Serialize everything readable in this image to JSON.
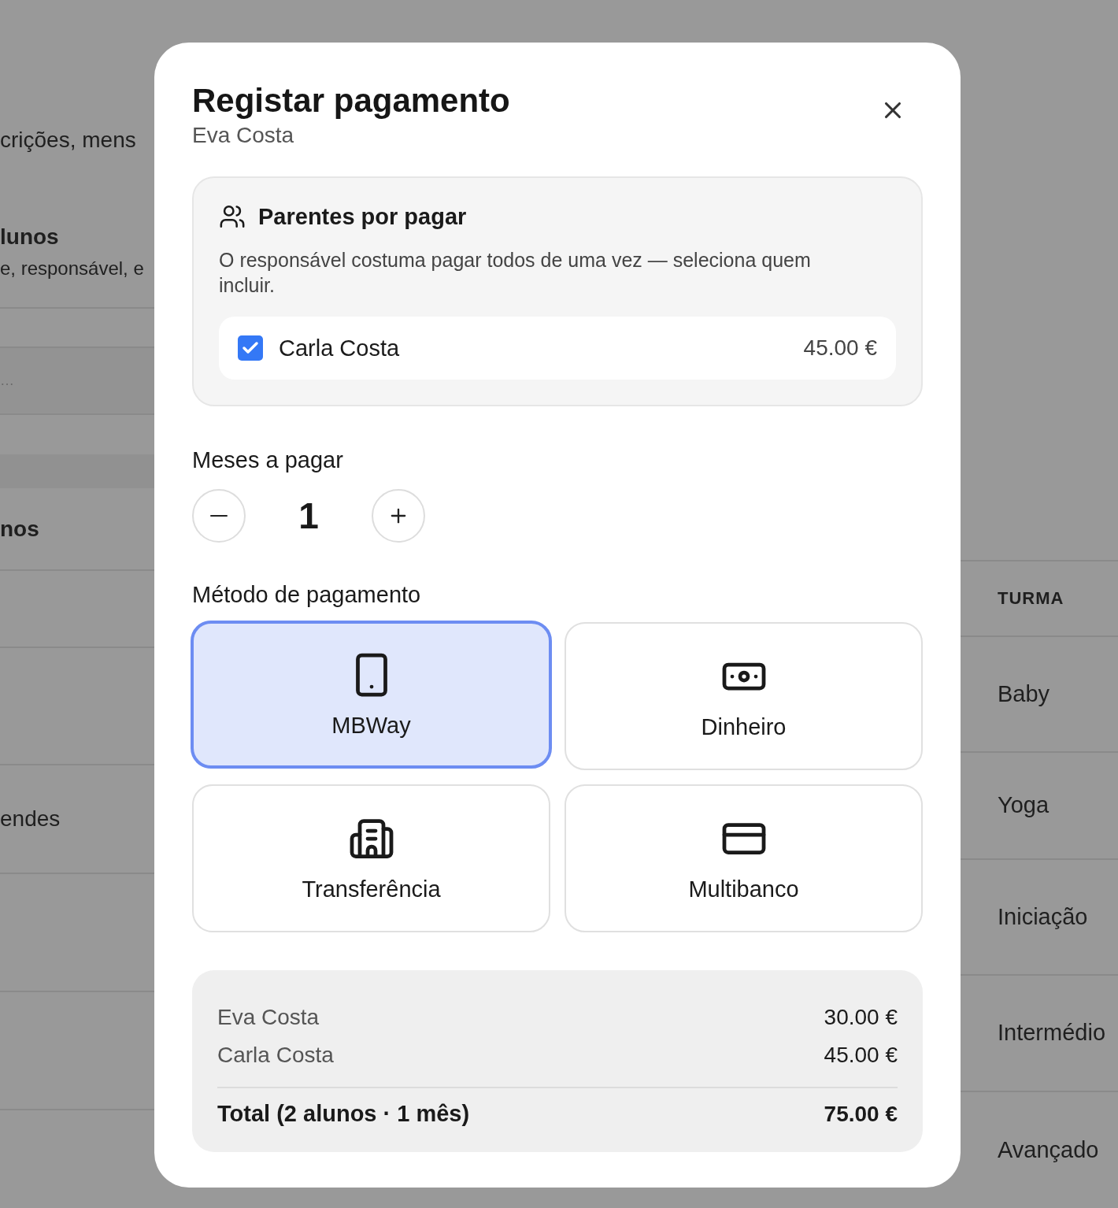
{
  "background": {
    "header_text": "crições, mens",
    "section_title": "lunos",
    "section_subtitle": "e, responsável, e",
    "field_text": "…",
    "list_title": "nos",
    "row_name": "endes",
    "table_column": "TURMA",
    "turma_cells": [
      "Baby",
      "Yoga",
      "Iniciação",
      "Intermédio",
      "Avançado"
    ]
  },
  "modal": {
    "title": "Registar pagamento",
    "subtitle": "Eva Costa",
    "relatives": {
      "title": "Parentes por pagar",
      "description": "O responsável costuma pagar todos de uma vez — seleciona quem incluir.",
      "items": [
        {
          "name": "Carla Costa",
          "amount": "45.00 €",
          "checked": true
        }
      ]
    },
    "months": {
      "label": "Meses a pagar",
      "value": "1"
    },
    "payment_methods": {
      "label": "Método de pagamento",
      "options": [
        {
          "label": "MBWay",
          "kind": "phone",
          "selected": true
        },
        {
          "label": "Dinheiro",
          "kind": "cash",
          "selected": false
        },
        {
          "label": "Transferência",
          "kind": "bank",
          "selected": false
        },
        {
          "label": "Multibanco",
          "kind": "card",
          "selected": false
        }
      ]
    },
    "summary": {
      "lines": [
        {
          "name": "Eva Costa",
          "amount": "30.00 €"
        },
        {
          "name": "Carla Costa",
          "amount": "45.00 €"
        }
      ],
      "total_label": "Total (2 alunos · 1 mês)",
      "total_amount": "75.00 €"
    }
  }
}
